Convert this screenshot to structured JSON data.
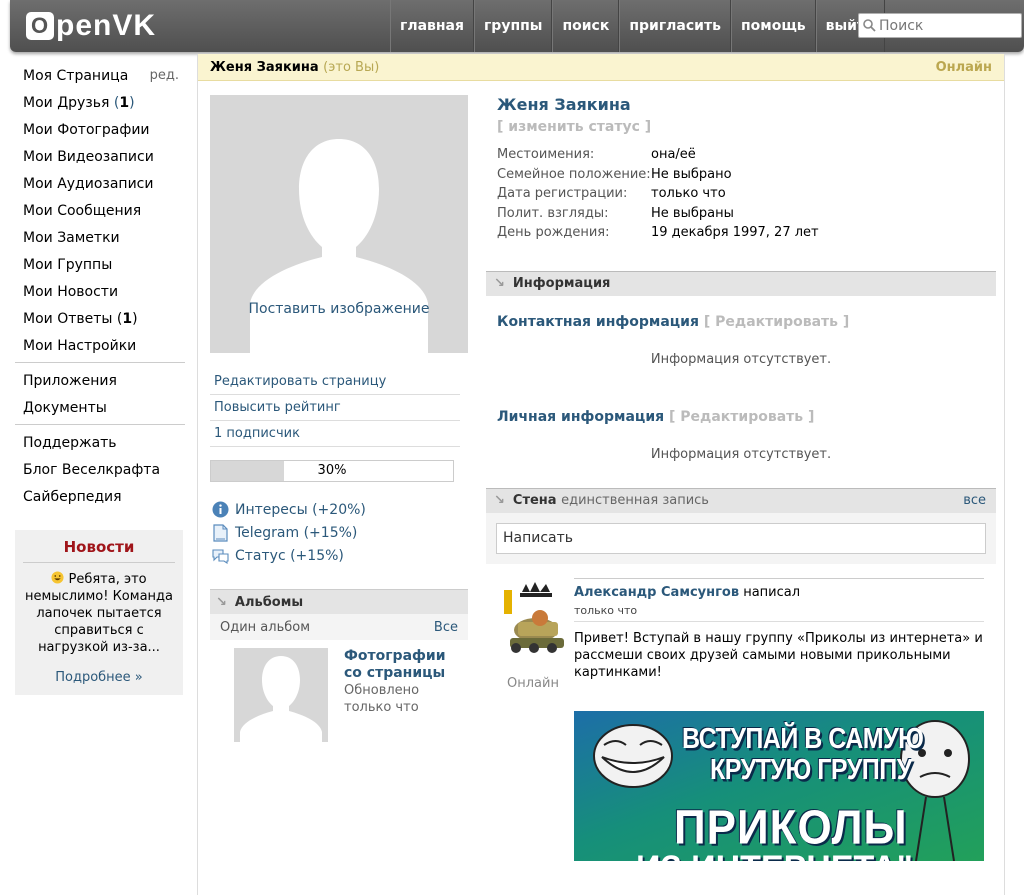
{
  "header": {
    "logo_letter": "O",
    "logo_rest": "penVK",
    "nav": [
      "главная",
      "группы",
      "поиск",
      "пригласить",
      "помощь",
      "выйти"
    ],
    "search_placeholder": "Поиск"
  },
  "sidebar": {
    "my_page": "Моя Страница",
    "my_page_edit": "ред.",
    "friends_label": "Мои Друзья",
    "friends_count": "1",
    "items_a": [
      "Мои Фотографии",
      "Мои Видеозаписи",
      "Мои Аудиозаписи",
      "Мои Сообщения",
      "Мои Заметки",
      "Мои Группы",
      "Мои Новости"
    ],
    "answers_label": "Мои Ответы",
    "answers_count": "1",
    "settings": "Мои Настройки",
    "items_b": [
      "Приложения",
      "Документы"
    ],
    "items_c": [
      "Поддержать",
      "Блог Веселкрафта",
      "Сайберпедия"
    ],
    "news": {
      "title": "Новости",
      "text": "Ребята, это немыслимо! Команда лапочек пытается справиться с нагрузкой из-за...",
      "more": "Подробнее »"
    }
  },
  "profile": {
    "head_name": "Женя Заякина",
    "head_you": "(это Вы)",
    "head_online": "Онлайн",
    "set_image": "Поставить изображение",
    "links": [
      "Редактировать страницу",
      "Повысить рейтинг",
      "1 подписчик"
    ],
    "rating": 30,
    "rating_label": "30%",
    "bonuses": [
      {
        "icon": "info-icon",
        "label": "Интересы (+20%)"
      },
      {
        "icon": "document-icon",
        "label": "Telegram (+15%)"
      },
      {
        "icon": "speech-bubble-icon",
        "label": "Статус (+15%)"
      }
    ],
    "albums": {
      "title": "Альбомы",
      "count": "Один альбом",
      "all": "Все",
      "album_title": "Фотографии со страницы",
      "album_updated": "Обновлено",
      "album_time": "только что"
    },
    "name": "Женя Заякина",
    "change_status": "[ изменить статус ]",
    "info": [
      {
        "k": "Местоимения:",
        "v": "она/её"
      },
      {
        "k": "Семейное положение:",
        "v": "Не выбрано"
      },
      {
        "k": "Дата регистрации:",
        "v": "только что"
      },
      {
        "k": "Полит. взгляды:",
        "v": "Не выбраны"
      },
      {
        "k": "День рождения:",
        "v": "19 декабря 1997, 27 лет"
      }
    ],
    "info_section": "Информация",
    "contact_title": "Контактная информация",
    "edit_bracket": "[ Редактировать ]",
    "no_info": "Информация отсутствует.",
    "personal_title": "Личная информация"
  },
  "wall": {
    "title": "Стена",
    "count": "единственная запись",
    "all": "все",
    "placeholder": "Написать",
    "post": {
      "author": "Александр Самсунгов",
      "wrote": "написал",
      "time": "только что",
      "online": "Онлайн",
      "text": "Привет! Вступай в нашу группу «Приколы из интернета» и рассмеши своих друзей самыми новыми прикольными картинками!",
      "image_line1": "ВСТУПАЙ В САМУЮ",
      "image_line2": "КРУТУЮ ГРУППУ",
      "image_line3": "ПРИКОЛЫ",
      "image_line4": "ИЗ ИНТЕРНЕТА\""
    }
  },
  "colors": {
    "link": "#2b587a",
    "news_title": "#a0151a",
    "header_bg": "#5a5a5a",
    "page_head_bg": "#faf4d0"
  }
}
